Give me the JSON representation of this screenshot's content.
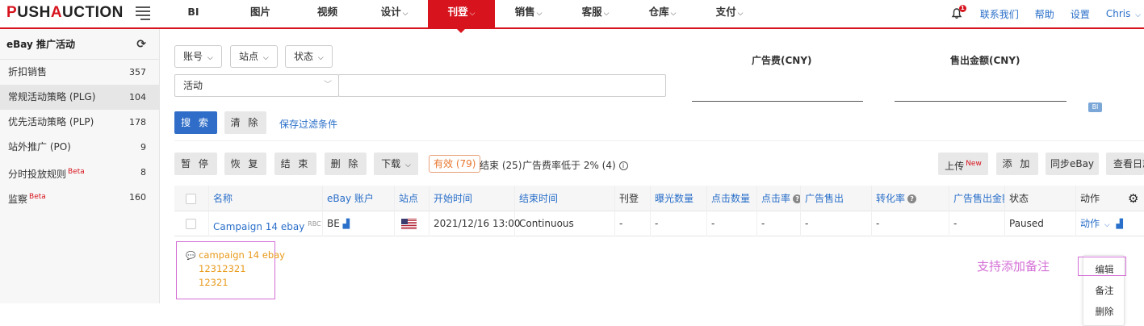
{
  "header": {
    "logo": {
      "p": "P",
      "rest1": "USH",
      "a": "A",
      "rest2": "UCTION"
    },
    "nav": [
      {
        "label": "BI",
        "caret": false,
        "active": false
      },
      {
        "label": "图片",
        "caret": false,
        "active": false
      },
      {
        "label": "视频",
        "caret": false,
        "active": false
      },
      {
        "label": "设计",
        "caret": true,
        "active": false
      },
      {
        "label": "刊登",
        "caret": true,
        "active": true
      },
      {
        "label": "销售",
        "caret": true,
        "active": false
      },
      {
        "label": "客服",
        "caret": true,
        "active": false
      },
      {
        "label": "仓库",
        "caret": true,
        "active": false
      },
      {
        "label": "支付",
        "caret": true,
        "active": false
      }
    ],
    "bell_badge": "1",
    "links": [
      "联系我们",
      "帮助",
      "设置",
      "Chris"
    ]
  },
  "sidebar": {
    "title": "eBay 推广活动",
    "items": [
      {
        "label": "折扣销售",
        "count": "357",
        "beta": ""
      },
      {
        "label": "常规活动策略 (PLG)",
        "count": "104",
        "beta": ""
      },
      {
        "label": "优先活动策略 (PLP)",
        "count": "178",
        "beta": ""
      },
      {
        "label": "站外推广 (PO)",
        "count": "9",
        "beta": ""
      },
      {
        "label": "分时投放规则",
        "count": "8",
        "beta": "Beta"
      },
      {
        "label": "监察",
        "count": "160",
        "beta": "Beta"
      }
    ]
  },
  "filters": {
    "account": "账号",
    "site": "站点",
    "status": "状态",
    "activity_select": "活动",
    "search_button": "搜 索",
    "clear_button": "清 除",
    "save_filter": "保存过滤条件"
  },
  "stats": {
    "ad_fee_label": "广告费(CNY)",
    "sales_label": "售出金额(CNY)",
    "bi_badge": "BI"
  },
  "toolbar": {
    "pause": "暂 停",
    "resume": "恢 复",
    "end": "结 束",
    "delete": "删 除",
    "download": "下载",
    "valid_tab": "有效 (79)",
    "ended_tab": "结束 (25)",
    "low_rate_tab": "广告费率低于 2% (4)",
    "upload": "上传",
    "upload_new": "New",
    "add": "添 加",
    "sync": "同步eBay",
    "view_log": "查看日志"
  },
  "table": {
    "headers": {
      "name": "名称",
      "account": "eBay 账户",
      "site": "站点",
      "start": "开始时间",
      "end": "结束时间",
      "listing": "刊登",
      "impressions": "曝光数量",
      "clicks": "点击数量",
      "ctr": "点击率",
      "ad_sales": "广告售出",
      "conversion": "转化率",
      "ad_sales_amount": "广告售出金额",
      "status": "状态",
      "action": "动作"
    },
    "row": {
      "name": "Campaign 14 ebay",
      "name_tag": "RBC",
      "account": "BE",
      "start": "2021/12/16 13:00",
      "end": "Continuous",
      "listing": "-",
      "impressions": "-",
      "clicks": "-",
      "ctr": "-",
      "ad_sales": "-",
      "conversion": "-",
      "ad_sales_amount": "-",
      "status": "Paused",
      "action": "动作"
    }
  },
  "note": {
    "lines": [
      "campaign 14 ebay",
      "12312321",
      "12321"
    ],
    "annotation": "支持添加备注"
  },
  "action_menu": {
    "items": [
      "编辑",
      "备注",
      "删除"
    ]
  }
}
